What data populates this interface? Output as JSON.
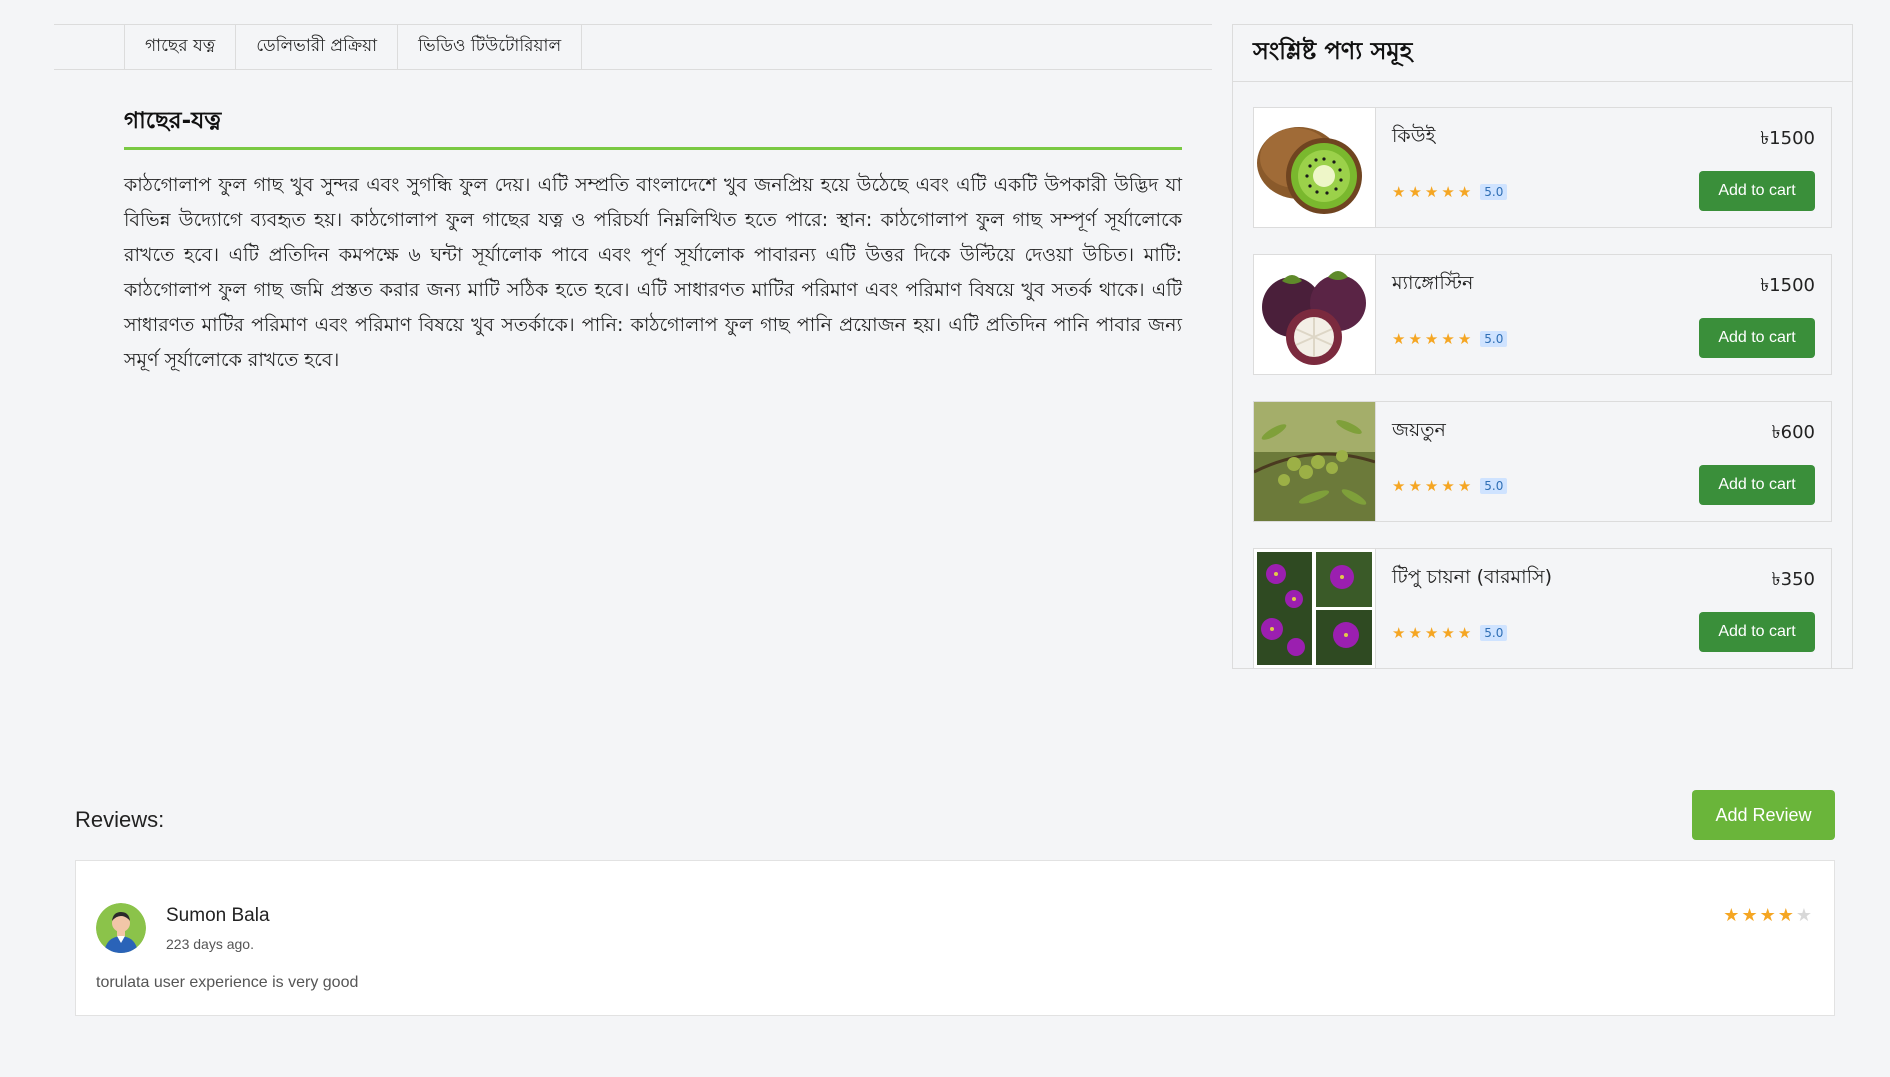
{
  "tabs": [
    {
      "label": "গাছের যত্ন"
    },
    {
      "label": "ডেলিভারী প্রক্রিয়া"
    },
    {
      "label": "ভিডিও টিউটোরিয়াল"
    }
  ],
  "care": {
    "title": "গাছের-যত্ন",
    "body": "কাঠগোলাপ ফুল গাছ খুব সুন্দর এবং সুগন্ধি ফুল দেয়। এটি সম্প্রতি বাংলাদেশে খুব জনপ্রিয় হয়ে উঠেছে এবং এটি একটি উপকারী উদ্ভিদ যা বিভিন্ন উদ্যোগে ব্যবহৃত হয়। কাঠগোলাপ ফুল গাছের যত্ন ও পরিচর্যা নিম্নলিখিত হতে পারে: স্থান: কাঠগোলাপ ফুল গাছ সম্পূর্ণ সূর্যালোকে রাখতে হবে। এটি প্রতিদিন কমপক্ষে ৬ ঘন্টা সূর্যালোক পাবে এবং পূর্ণ সূর্যালোক পাবারন্য এটি উত্তর দিকে উল্টিয়ে দেওয়া উচিত। মাটি: কাঠগোলাপ ফুল গাছ জমি প্রস্তত করার জন্য মাটি সঠিক হতে হবে। এটি সাধারণত মাটির পরিমাণ এবং পরিমাণ বিষয়ে খুব সতর্ক থাকে। এটি সাধারণত মাটির পরিমাণ এবং পরিমাণ বিষয়ে খুব সতর্কাকে। পানি: কাঠগোলাপ ফুল গাছ পানি প্রয়োজন হয়। এটি প্রতিদিন পানি পাবার জন্য সমূর্ণ সূর্যালোকে রাখতে হবে।"
  },
  "related": {
    "title": "সংশ্লিষ্ট পণ্য সমূহ",
    "products": [
      {
        "name": "কিউই",
        "price": "৳1500",
        "rating": "5.0",
        "stars": 5,
        "image": "kiwi",
        "cart_label": "Add to cart"
      },
      {
        "name": "ম্যাঙ্গোস্টিন",
        "price": "৳1500",
        "rating": "5.0",
        "stars": 5,
        "image": "mangosteen",
        "cart_label": "Add to cart"
      },
      {
        "name": "জয়তুন",
        "price": "৳600",
        "rating": "5.0",
        "stars": 5,
        "image": "olive",
        "cart_label": "Add to cart"
      },
      {
        "name": "টিপু চায়না (বারমাসি)",
        "price": "৳350",
        "rating": "5.0",
        "stars": 5,
        "image": "purple-flowers",
        "cart_label": "Add to cart"
      }
    ]
  },
  "reviews": {
    "heading": "Reviews:",
    "add_label": "Add Review",
    "items": [
      {
        "name": "Sumon Bala",
        "time": "223 days ago.",
        "text": "torulata user experience is very good",
        "stars": 4
      }
    ]
  },
  "colors": {
    "accent_green": "#3a8f3a",
    "add_review_green": "#6ab53a",
    "underline_green": "#7ac943",
    "star": "#f5a623"
  }
}
